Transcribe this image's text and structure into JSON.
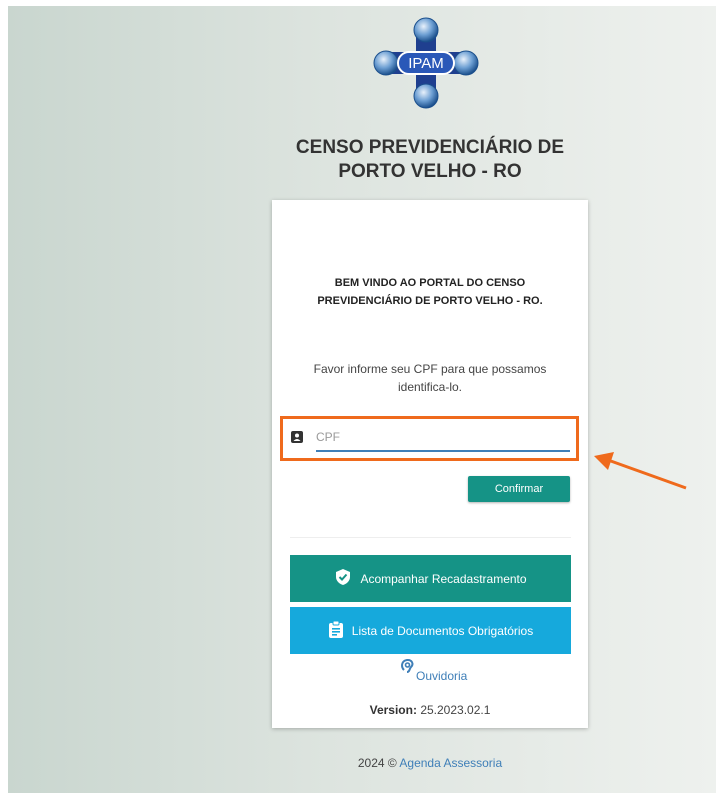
{
  "header": {
    "logo_text": "IPAM",
    "title": "CENSO PREVIDENCIÁRIO DE\nPORTO VELHO - RO"
  },
  "card": {
    "welcome": "BEM VINDO AO PORTAL DO CENSO\nPREVIDENCIÁRIO DE PORTO VELHO - RO.",
    "instruction": "Favor informe seu CPF para que possamos\nidentifica-lo.",
    "cpf": {
      "placeholder": "CPF",
      "value": ""
    },
    "confirm_label": "Confirmar",
    "track_label": "Acompanhar Recadastramento",
    "docs_label": "Lista de Documentos Obrigatórios",
    "ouvidoria_label": "Ouvidoria",
    "version_label": "Version:",
    "version_value": "25.2023.02.1"
  },
  "footer": {
    "prefix": "2024 ©",
    "company": "Agenda Assessoria"
  },
  "colors": {
    "teal": "#159386",
    "cyan": "#16a9dc",
    "link": "#3f7fb8",
    "highlight": "#ef6a1c"
  },
  "icons": [
    "contact-card-icon",
    "shield-check-icon",
    "clipboard-icon",
    "ear-icon",
    "arrow-annotation-icon"
  ]
}
